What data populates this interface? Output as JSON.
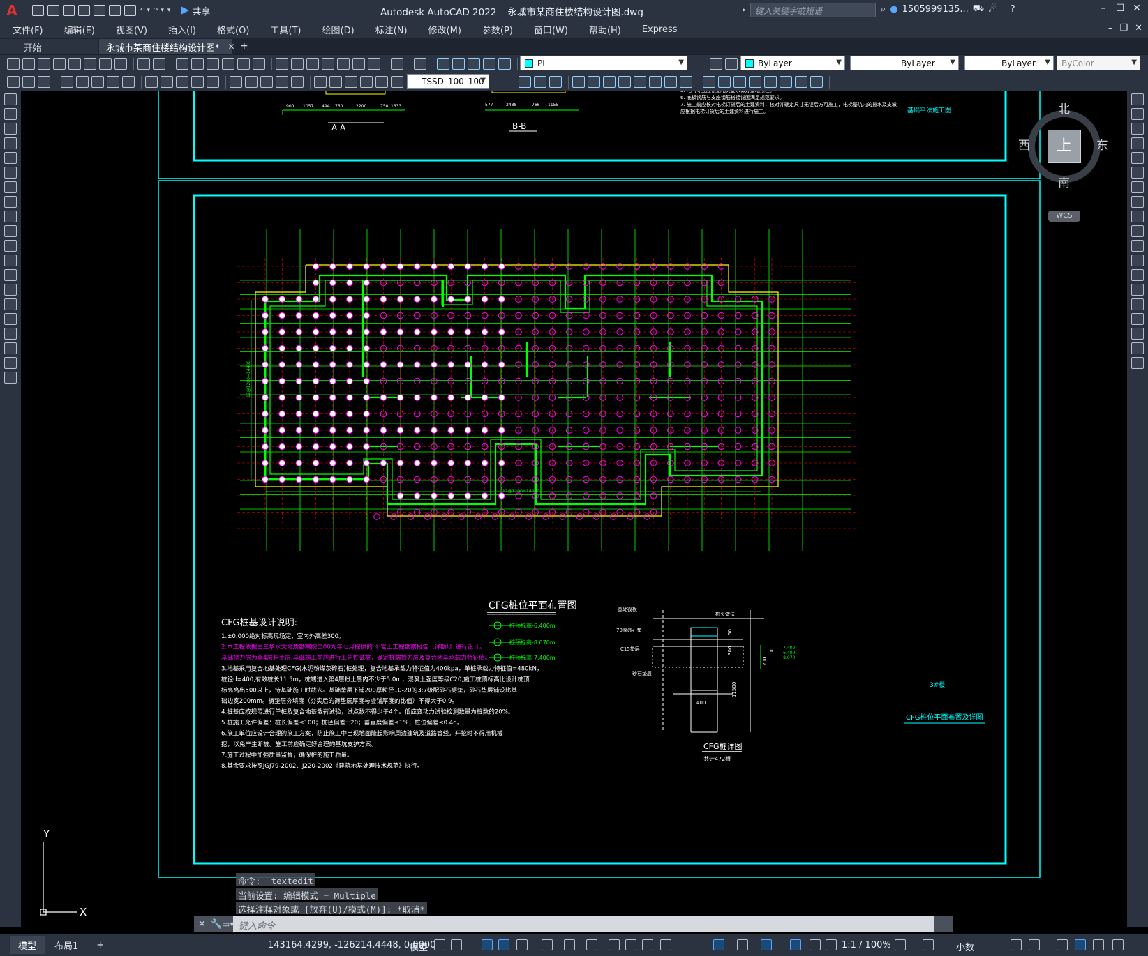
{
  "app": {
    "name": "Autodesk AutoCAD 2022",
    "file": "永城市某商住楼结构设计图.dwg",
    "logo": "A",
    "share_label": "共享",
    "search_placeholder": "键入关键字或短语",
    "user": "1505999135...",
    "colors": {
      "title_bg": "#2b3240",
      "accent": "#58a6ff",
      "cyan": "#00ffff",
      "magenta": "#ff00ff",
      "green": "#00ff00",
      "red": "#ff0000",
      "yellow": "#ffff00"
    }
  },
  "menu": [
    "文件(F)",
    "编辑(E)",
    "视图(V)",
    "插入(I)",
    "格式(O)",
    "工具(T)",
    "绘图(D)",
    "标注(N)",
    "修改(M)",
    "参数(P)",
    "窗口(W)",
    "帮助(H)",
    "Express"
  ],
  "tabs": {
    "start": "开始",
    "active": "永城市某商住楼结构设计图*",
    "close": "✕",
    "add": "+"
  },
  "toolbar": {
    "layer": "PL",
    "color": "ByLayer",
    "linetype": "ByLayer",
    "lineweight": "ByLayer",
    "plotstyle": "ByColor",
    "dimstyle": "TSSD_100_100"
  },
  "viewcube": {
    "north": "北",
    "south": "南",
    "east": "东",
    "west": "西",
    "face": "上",
    "wcs": "WCS"
  },
  "drawing": {
    "section_aa": "A-A",
    "section_bb": "B-B",
    "dims_aa": [
      "900",
      "1057",
      "494",
      "750",
      "2200",
      "750",
      "1333"
    ],
    "dims_bb": [
      "577",
      "2488",
      "766",
      "1155"
    ],
    "top_notes": [
      "5. 电气专业应依据相关要求做好接地预埋。",
      "6. 底板钢筋与支座钢筋搭接锚固满足规范要求。",
      "7. 施工前应核对电梯订货后的土建资料，核对并确定尺寸无误后方可施工，电梯基坑内的排水及支墩",
      "应根据电梯订货后的土建资料进行施工。"
    ],
    "top_right_title": "基础平法施工图",
    "plan_title": "CFG桩位平面布置图",
    "dim_vertical": "12@1200=14400",
    "dim_bottom": "12@1200=14400",
    "legend": [
      "桩顶标高-6.400m",
      "桩顶标高-8.070m",
      "桩顶标高-7.400m"
    ],
    "notes_title": "CFG桩基设计说明:",
    "notes": [
      "1.±0.000绝对标高现场定，室内外高差300。",
      "2.本工程依据由三华水文地质勘察院二00九年七月提供的《    岩土工程勘察报告（详勘）》进行设计。",
      "基础持力层为第4层粉土层,基础施工前应进行工艺性试桩，确定桩端持力层及复合地基承载力特征值。",
      "3.地基采用复合地基处理CFG(水泥粉煤灰碎石)桩处理，复合地基承载力特征值为400kpa，单桩承载力特征值=480kN，",
      "桩径d=400,有效桩长11.5m，桩端进入第4层粉土层内不少于5.0m，混凝土强度等级C20,施工桩顶标高比设计桩顶",
      "标高高出500以上，待基础施工时截去。基础垫层下铺200厚粒径10-20的3:7级配砂石褥垫，砂石垫层铺设比基",
      "础边宽200mm。褥垫层夯填度（夯实后的褥垫层厚度与虚铺厚度的比值）不得大于0.9。",
      "4.桩基应按规范进行单桩及复合地基载荷试验，试点数不得少于4个。低应变动力试验检测数量为桩数的20%。",
      "5.桩施工允许偏差：桩长偏差≤100；桩径偏差±20；垂直度偏差≤1%；桩位偏差≤0.4d。",
      "6.施工单位应设计合理的施工方案，防止施工中出现地面隆起影响周边建筑及道路管线。开挖时不得用机械",
      "挖，以免产生断桩。施工前应确定好合理的基坑支护方案。",
      "7.施工过程中加强质量监督，确保桩的施工质量。",
      "8.其余要求按照JGJ79-2002、J220-2002《建筑地基处理技术规范》执行。"
    ],
    "detail_labels": {
      "mat": "基础筏板",
      "cap": "桩头做法",
      "cushion": "70厚砂石垫",
      "c15": "C15垫层",
      "gravel": "砂石垫层",
      "d400": "400",
      "len": "11500",
      "e1": "-7.400",
      "e2": "-6.400",
      "e3": "-8.070",
      "d50": "50",
      "d300": "300",
      "d200": "200",
      "d100": "100",
      "title": "CFG桩详图",
      "count": "共计472根"
    },
    "sheet_label": "3#楼",
    "sheet_title": "CFG桩位平面布置及详图",
    "ucs_x": "X",
    "ucs_y": "Y"
  },
  "command": {
    "history": [
      "命令: _textedit",
      "当前设置: 编辑模式 = Multiple",
      "选择注释对象或 [放弃(U)/模式(M)]: *取消*"
    ],
    "prompt": "键入命令"
  },
  "status": {
    "tabs": [
      "模型",
      "布局1"
    ],
    "coords": "143164.4299, -126214.4448, 0.0000",
    "space": "模型",
    "scale": "1:1 / 100%",
    "units": "小数"
  }
}
